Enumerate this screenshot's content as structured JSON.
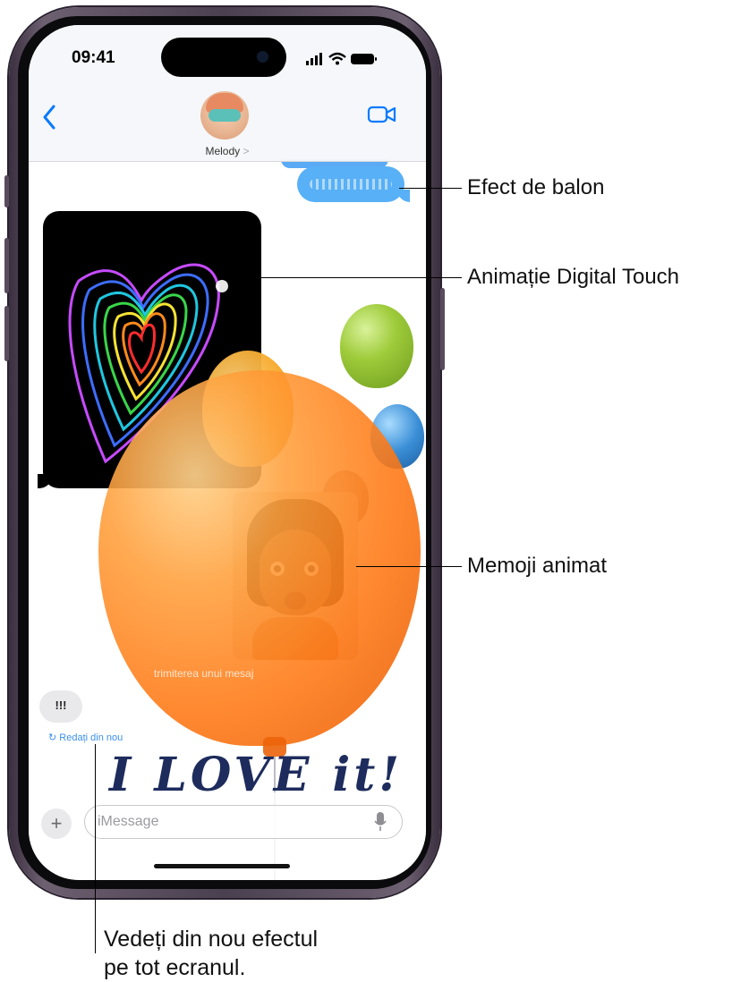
{
  "status_bar": {
    "time": "09:41"
  },
  "header": {
    "contact_name": "Melody",
    "contact_chevron": ">"
  },
  "conversation": {
    "reaction_text": "!!!",
    "replay_label": "Redați din nou",
    "status_caption": "trimiterea unui mesaj",
    "sticker_text": "I LOVE it!"
  },
  "compose": {
    "plus_label": "+",
    "placeholder": "iMessage"
  },
  "callouts": {
    "bubble_effect": "Efect de balon",
    "digital_touch": "Animație Digital Touch",
    "memoji": "Memoji animat",
    "replay_line1": "Vedeți din nou efectul",
    "replay_line2": "pe tot ecranul."
  },
  "colors": {
    "accent_blue": "#0a7aff",
    "bubble_blue": "#58b0f6",
    "balloon_orange": "#ff8a1c"
  }
}
